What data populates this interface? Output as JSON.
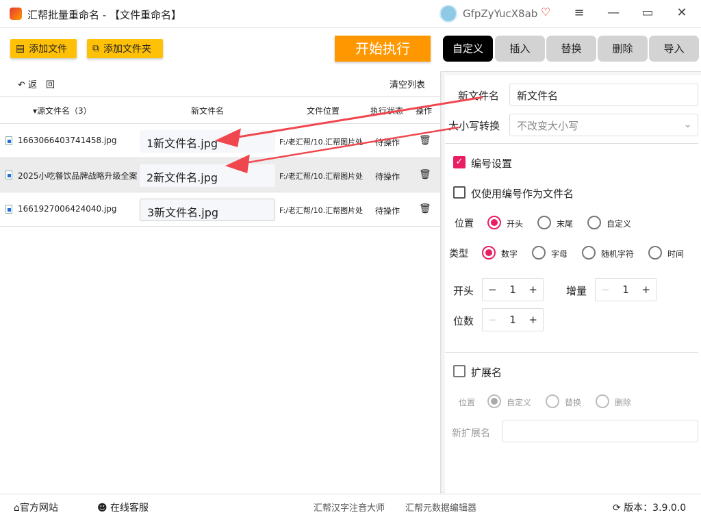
{
  "app": {
    "title": "汇帮批量重命名 - 【文件重命名】",
    "user": "GfpZyYucX8ab"
  },
  "window": {
    "menu": "≡",
    "minimize": "—",
    "maximize": "▭",
    "close": "✕"
  },
  "toolbar": {
    "add_file": "添加文件",
    "add_folder": "添加文件夹",
    "start": "开始执行",
    "back": "返　回",
    "clear": "清空列表"
  },
  "tabs": [
    {
      "label": "自定义",
      "active": true
    },
    {
      "label": "插入"
    },
    {
      "label": "替换"
    },
    {
      "label": "删除"
    },
    {
      "label": "导入"
    }
  ],
  "table": {
    "headers": [
      "源文件名（3）",
      "新文件名",
      "文件位置",
      "执行状态",
      "操作"
    ],
    "rows": [
      {
        "source": "1663066403741458.jpg",
        "new": "1新文件名.jpg",
        "location": "F:/老汇帮/10.汇帮图片处",
        "status": "待操作"
      },
      {
        "source": "2025小吃餐饮品牌战略升级全案",
        "new": "2新文件名.jpg",
        "location": "F:/老汇帮/10.汇帮图片处",
        "status": "待操作"
      },
      {
        "source": "1661927006424040.jpg",
        "new": "3新文件名.jpg",
        "location": "F:/老汇帮/10.汇帮图片处",
        "status": "待操作"
      }
    ]
  },
  "settings": {
    "new_name_label": "新文件名",
    "new_name_value": "新文件名",
    "case_label": "大小写转换",
    "case_value": "不改变大小写",
    "numbering_label": "编号设置",
    "numbering_checked": true,
    "only_number_label": "仅使用编号作为文件名",
    "only_number_checked": false,
    "position_label": "位置",
    "position_options": [
      "开头",
      "末尾",
      "自定义"
    ],
    "position_selected": "开头",
    "type_label": "类型",
    "type_options": [
      "数字",
      "字母",
      "随机字符",
      "时间"
    ],
    "type_selected": "数字",
    "start_label": "开头",
    "start_value": "1",
    "increment_label": "增量",
    "increment_value": "1",
    "digits_label": "位数",
    "digits_value": "1",
    "ext_label": "扩展名",
    "ext_checked": false,
    "ext_position_label": "位置",
    "ext_position_options": [
      "自定义",
      "替换",
      "删除"
    ],
    "ext_position_selected": "自定义",
    "new_ext_label": "新扩展名",
    "new_ext_value": ""
  },
  "footer": {
    "website": "官方网站",
    "support": "在线客服",
    "link1": "汇帮汉字注音大师",
    "link2": "汇帮元数据编辑器",
    "version": "版本：3.9.0.0"
  },
  "colors": {
    "accent": "#e91e63",
    "start": "#ff9800",
    "yellow": "#ffc107",
    "arrow": "#f0474f"
  }
}
